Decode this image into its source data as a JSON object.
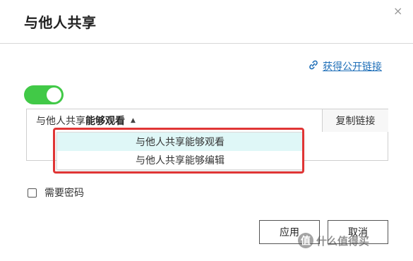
{
  "dialog": {
    "title": "与他人共享",
    "close_icon": "×"
  },
  "public_link": {
    "icon": "link-icon",
    "label": "获得公开链接"
  },
  "toggle": {
    "state": "on",
    "color": "#41c947"
  },
  "share": {
    "select_label": "与他人共享",
    "select_value": "能够观看",
    "caret": "▲",
    "copy_label": "复制链接"
  },
  "dropdown": {
    "options": [
      {
        "label": "与他人共享能够观看",
        "highlighted": true
      },
      {
        "label": "与他人共享能够编辑",
        "highlighted": false
      }
    ],
    "highlight_color": "#dff7f7",
    "annotation_color": "#e03535"
  },
  "password": {
    "label": "需要密码",
    "checked": false
  },
  "buttons": {
    "apply": "应用",
    "cancel": "取消"
  },
  "watermark": {
    "logo": "值",
    "text": "什么值得买"
  }
}
